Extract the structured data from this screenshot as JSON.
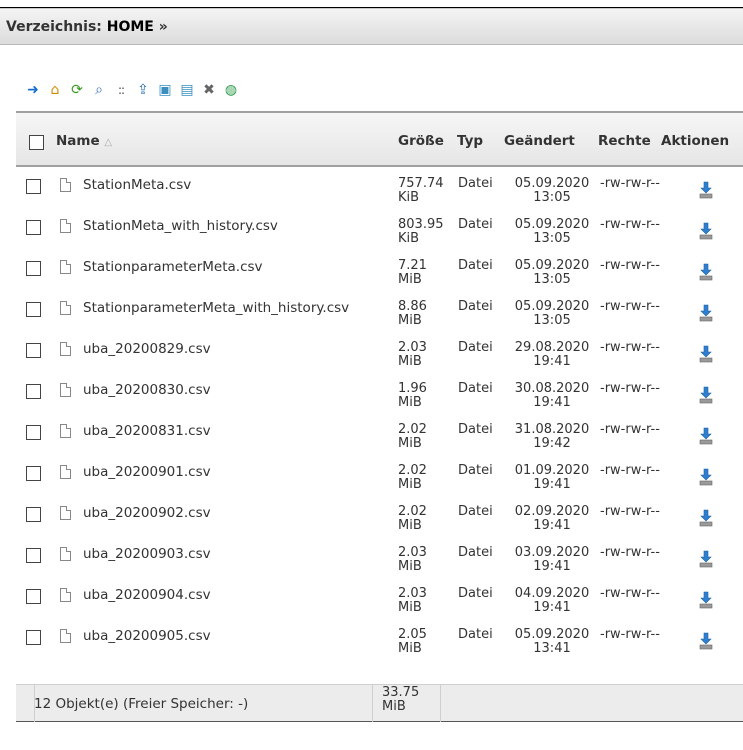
{
  "directory": {
    "label": "Verzeichnis:",
    "path": "HOME",
    "arrow": "»"
  },
  "toolbar": [
    {
      "name": "go-icon",
      "glyph": "➜",
      "color": "#1a6fd0"
    },
    {
      "name": "home-icon",
      "glyph": "⌂",
      "color": "#d08a00"
    },
    {
      "name": "refresh-icon",
      "glyph": "⟳",
      "color": "#3a9a20"
    },
    {
      "name": "search-icon",
      "glyph": "⌕",
      "color": "#3a6fb8"
    },
    {
      "name": "separator-icon",
      "glyph": "::",
      "color": "#444"
    },
    {
      "name": "upload-icon",
      "glyph": "⇪",
      "color": "#2a6fb0"
    },
    {
      "name": "copy-icon",
      "glyph": "▣",
      "color": "#3a8fc0"
    },
    {
      "name": "move-icon",
      "glyph": "▤",
      "color": "#3a8fc0"
    },
    {
      "name": "delete-icon",
      "glyph": "✖",
      "color": "#666"
    },
    {
      "name": "archive-icon",
      "glyph": "◍",
      "color": "#2a9a4a"
    }
  ],
  "columns": {
    "name": "Name",
    "sort_marker": "△",
    "size": "Größe",
    "type": "Typ",
    "changed": "Geändert",
    "rights": "Rechte",
    "actions": "Aktionen"
  },
  "files": [
    {
      "name": "StationMeta.csv",
      "size": "757.74 KiB",
      "type": "Datei",
      "date": "05.09.2020",
      "time": "13:05",
      "rights": "-rw-rw-r--"
    },
    {
      "name": "StationMeta_with_history.csv",
      "size": "803.95 KiB",
      "type": "Datei",
      "date": "05.09.2020",
      "time": "13:05",
      "rights": "-rw-rw-r--"
    },
    {
      "name": "StationparameterMeta.csv",
      "size": "7.21 MiB",
      "type": "Datei",
      "date": "05.09.2020",
      "time": "13:05",
      "rights": "-rw-rw-r--"
    },
    {
      "name": "StationparameterMeta_with_history.csv",
      "size": "8.86 MiB",
      "type": "Datei",
      "date": "05.09.2020",
      "time": "13:05",
      "rights": "-rw-rw-r--"
    },
    {
      "name": "uba_20200829.csv",
      "size": "2.03 MiB",
      "type": "Datei",
      "date": "29.08.2020",
      "time": "19:41",
      "rights": "-rw-rw-r--"
    },
    {
      "name": "uba_20200830.csv",
      "size": "1.96 MiB",
      "type": "Datei",
      "date": "30.08.2020",
      "time": "19:41",
      "rights": "-rw-rw-r--"
    },
    {
      "name": "uba_20200831.csv",
      "size": "2.02 MiB",
      "type": "Datei",
      "date": "31.08.2020",
      "time": "19:42",
      "rights": "-rw-rw-r--"
    },
    {
      "name": "uba_20200901.csv",
      "size": "2.02 MiB",
      "type": "Datei",
      "date": "01.09.2020",
      "time": "19:41",
      "rights": "-rw-rw-r--"
    },
    {
      "name": "uba_20200902.csv",
      "size": "2.02 MiB",
      "type": "Datei",
      "date": "02.09.2020",
      "time": "19:41",
      "rights": "-rw-rw-r--"
    },
    {
      "name": "uba_20200903.csv",
      "size": "2.03 MiB",
      "type": "Datei",
      "date": "03.09.2020",
      "time": "19:41",
      "rights": "-rw-rw-r--"
    },
    {
      "name": "uba_20200904.csv",
      "size": "2.03 MiB",
      "type": "Datei",
      "date": "04.09.2020",
      "time": "19:41",
      "rights": "-rw-rw-r--"
    },
    {
      "name": "uba_20200905.csv",
      "size": "2.05 MiB",
      "type": "Datei",
      "date": "05.09.2020",
      "time": "13:41",
      "rights": "-rw-rw-r--"
    }
  ],
  "footer": {
    "summary": "12 Objekt(e) (Freier Speicher: -)",
    "total_size": "33.75 MiB"
  }
}
